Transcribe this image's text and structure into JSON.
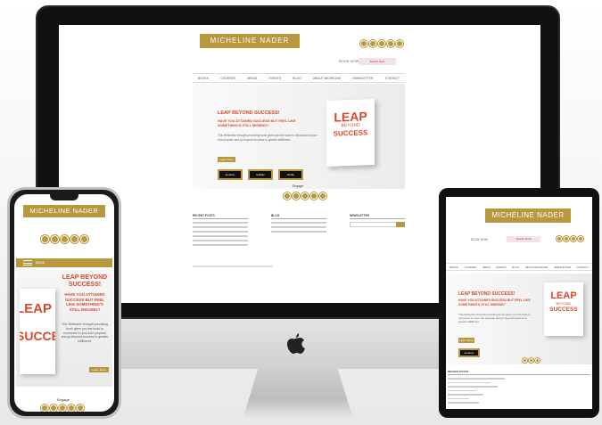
{
  "brand": "MICHELINE NADER",
  "search": {
    "label": "BOOK NOW",
    "button": "Search Here"
  },
  "nav": [
    "BOOKS",
    "COURSES",
    "MEDIA",
    "EVENTS",
    "BLOG",
    "ABOUT MICHELINE",
    "NEWSLETTER",
    "CONTACT"
  ],
  "hero": {
    "title": "LEAP BEYOND SUCCESS!",
    "subtitle": "HAVE YOU ATTAINED SUCCESS BUT FEEL LIKE SOMETHING'S STILL MISSING?",
    "body": "This Reflective thought-provoking book gives you the tools to reconnect to your true purpose and go beyond success to greater fulfillment.",
    "button": "Learn More",
    "stores": [
      "amazon",
      "audible",
      "kindle"
    ]
  },
  "book": {
    "leap": "LEAP",
    "beyond": "BEYOND",
    "success": "SUCCESS"
  },
  "phone_menu": "MENU",
  "follow": "Engage",
  "footer": {
    "col1": "RECENT POSTS",
    "col2": "BLOG",
    "col3": "NEWSLETTER"
  },
  "colors": {
    "gold": "#b8973e",
    "accent_red": "#d9472b"
  }
}
